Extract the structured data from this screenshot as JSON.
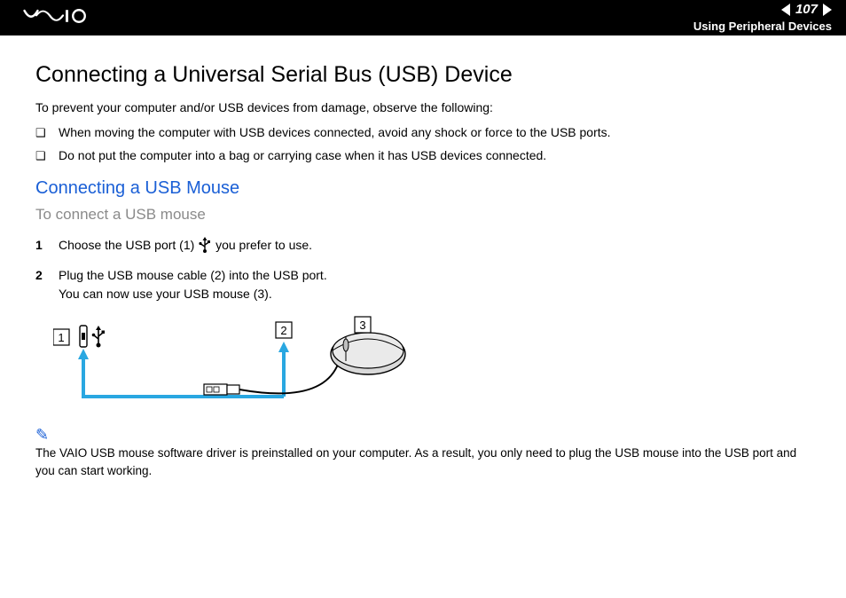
{
  "header": {
    "logo_text": "VAIO",
    "page_number": "107",
    "section": "Using Peripheral Devices"
  },
  "title": "Connecting a Universal Serial Bus (USB) Device",
  "intro": "To prevent your computer and/or USB devices from damage, observe the following:",
  "bullets": [
    "When moving the computer with USB devices connected, avoid any shock or force to the USB ports.",
    "Do not put the computer into a bag or carrying case when it has USB devices connected."
  ],
  "subheading": "Connecting a USB Mouse",
  "task": "To connect a USB mouse",
  "steps": [
    {
      "pre": "Choose the USB port (1) ",
      "post": " you prefer to use."
    },
    {
      "pre": "Plug the USB mouse cable (2) into the USB port.\nYou can now use your USB mouse (3).",
      "post": ""
    }
  ],
  "diagram_labels": {
    "l1": "1",
    "l2": "2",
    "l3": "3"
  },
  "note": "The VAIO USB mouse software driver is preinstalled on your computer. As a result, you only need to plug the USB mouse into the USB port and you can start working.",
  "colors": {
    "accent": "#1a5fd6",
    "diagram_line": "#29a7e1"
  }
}
